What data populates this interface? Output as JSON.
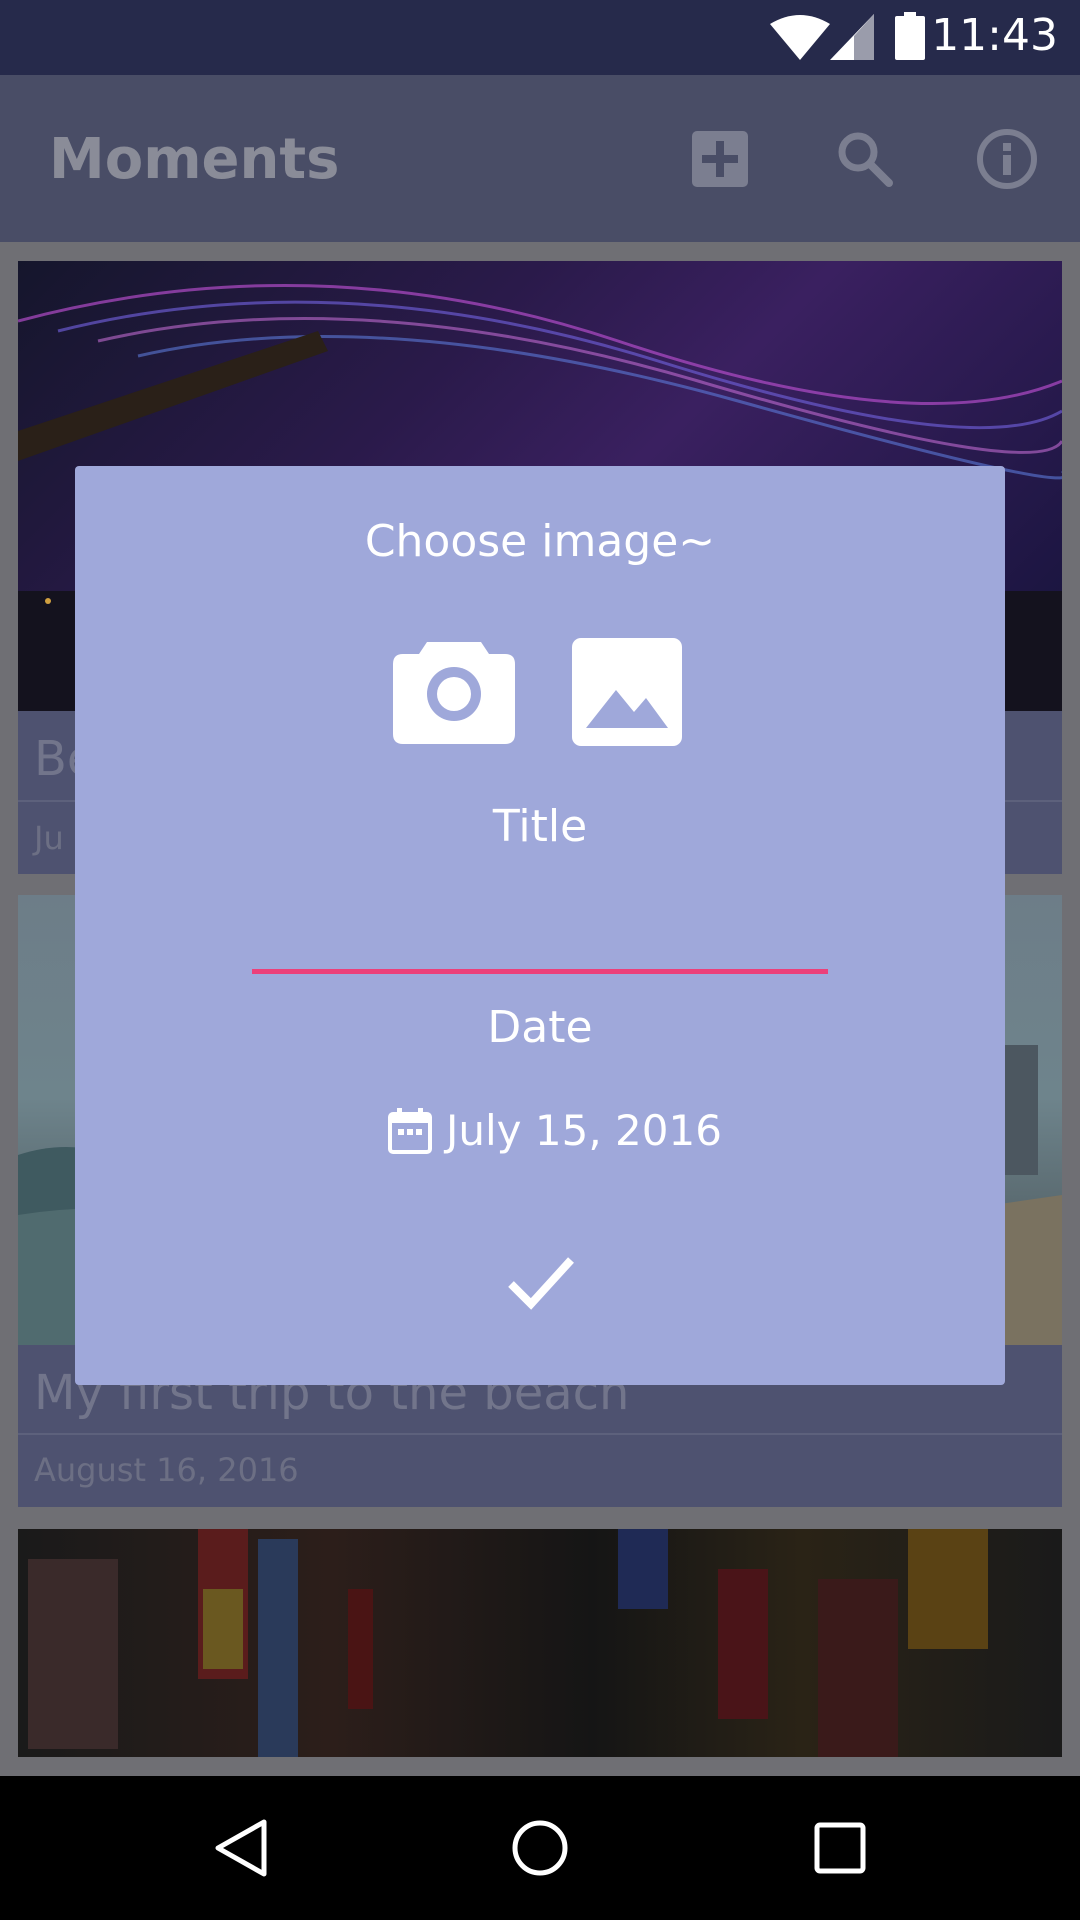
{
  "status_bar": {
    "time": "11:43"
  },
  "app_bar": {
    "title": "Moments",
    "actions": [
      "add-box-icon",
      "search-icon",
      "info-icon"
    ]
  },
  "cards": [
    {
      "title": "Be",
      "date": "Ju"
    },
    {
      "title": "My first trip to the beach",
      "date": "August 16, 2016"
    }
  ],
  "dialog": {
    "heading": "Choose image~",
    "source_buttons": [
      "camera-icon",
      "image-icon"
    ],
    "title_label": "Title",
    "title_value": "",
    "date_label": "Date",
    "date_value": "July 15, 2016",
    "confirm": "check-icon",
    "accent_color": "#ec407a",
    "background_color": "#9fa8da"
  },
  "nav_bar": {
    "buttons": [
      "back-icon",
      "home-icon",
      "recents-icon"
    ]
  }
}
